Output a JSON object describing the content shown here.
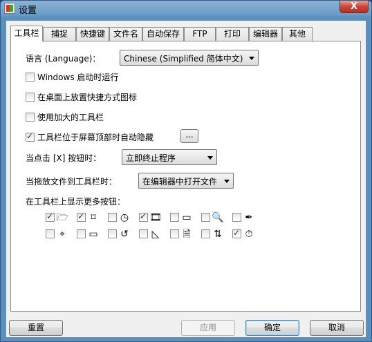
{
  "window": {
    "title": "设置",
    "close_glyph": "X"
  },
  "tabs": [
    "工具栏",
    "捕捉",
    "快捷键",
    "文件名",
    "自动保存",
    "FTP",
    "打印",
    "编辑器",
    "其他"
  ],
  "language": {
    "label": "语言 (Language)：",
    "value": "Chinese (Simplified 简体中文)"
  },
  "options": [
    {
      "label": "Windows 启动时运行",
      "checked": false
    },
    {
      "label": "在桌面上放置快捷方式图标",
      "checked": false
    },
    {
      "label": "使用加大的工具栏",
      "checked": false
    },
    {
      "label": "工具栏位于屏幕顶部时自动隐藏",
      "checked": true
    }
  ],
  "ellipsis_button": "...",
  "close_click": {
    "label": "当点击 [X] 按钮时：",
    "value": "立即终止程序"
  },
  "drag_file": {
    "label": "当拖放文件到工具栏时：",
    "value": "在编辑器中打开文件"
  },
  "more_buttons": {
    "label": "在工具栏上显示更多按钮：",
    "row1": [
      {
        "icon": "folder-open-icon",
        "glyph": "🗁",
        "checked": true
      },
      {
        "icon": "crop-icon",
        "glyph": "⌑",
        "checked": true
      },
      {
        "icon": "clock-icon",
        "glyph": "◷",
        "checked": false
      },
      {
        "icon": "film-icon",
        "glyph": "🎞",
        "checked": true
      },
      {
        "icon": "rectangle-icon",
        "glyph": "▭",
        "checked": false
      },
      {
        "icon": "magnifier-icon",
        "glyph": "🔍",
        "checked": false
      },
      {
        "icon": "color-picker-icon",
        "glyph": "✒",
        "checked": false
      }
    ],
    "row2": [
      {
        "icon": "crosshair-icon",
        "glyph": "⌖",
        "checked": false
      },
      {
        "icon": "ruler-icon",
        "glyph": "▭",
        "checked": false
      },
      {
        "icon": "rotate-icon",
        "glyph": "↺",
        "checked": false
      },
      {
        "icon": "triangle-ruler-icon",
        "glyph": "◺",
        "checked": false
      },
      {
        "icon": "pdf-icon",
        "glyph": "🗎",
        "checked": false
      },
      {
        "icon": "split-icon",
        "glyph": "⇅",
        "checked": false
      },
      {
        "icon": "stopwatch-icon",
        "glyph": "⏱",
        "checked": true
      }
    ]
  },
  "buttons": {
    "reset": "重置",
    "apply": "应用",
    "ok": "确定",
    "cancel": "取消"
  }
}
